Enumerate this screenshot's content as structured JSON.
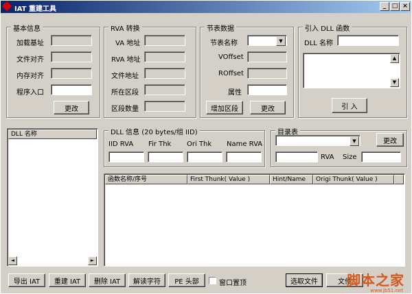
{
  "window": {
    "title": "IAT 重建工具"
  },
  "titlebar_buttons": {
    "minimize": "_",
    "maximize": "□",
    "close": "×"
  },
  "basic_info": {
    "title": "基本信息",
    "load_base": "加载基址",
    "file_align": "文件对齐",
    "mem_align": "内存对齐",
    "entry_point": "程序入口",
    "change_button": "更改"
  },
  "rva_convert": {
    "title": "RVA 转换",
    "va_addr": "VA 地址",
    "rva_addr": "RVA 地址",
    "file_addr": "文件地址",
    "section": "所在区段",
    "section_count": "区段数量"
  },
  "section_table": {
    "title": "节表数据",
    "section_name": "节表名称",
    "voffset": "VOffset",
    "roffset": "ROffset",
    "attribute": "属性",
    "add_section_button": "增加区段",
    "change_button": "更改"
  },
  "import_dll": {
    "title": "引入 DLL 函数",
    "dll_name_label": "DLL 名称",
    "import_button": "引 入"
  },
  "dll_list": {
    "header": "DLL 名称"
  },
  "dll_info": {
    "title": "DLL 信息 (20 bytes/组 IID)",
    "iid_rva": "IID RVA",
    "fir_thk": "Fir Thk",
    "ori_thk": "Ori Thk",
    "name_rva": "Name RVA"
  },
  "directory": {
    "title": "目录表",
    "change_button": "更改",
    "rva_label": "RVA",
    "size_label": "Size"
  },
  "func_table": {
    "columns": [
      "函数名称/序号",
      "First Thunk( Value )",
      "Hint/Name",
      "Origi Thunk( Value )"
    ]
  },
  "bottom_bar": {
    "export_iat": "导出 IAT",
    "rebuild_iat": "重建 IAT",
    "delete_iat": "删除 IAT",
    "decode_string": "解读字符",
    "pe_header": "PE 头部",
    "topmost_label": "窗口置顶",
    "select_file": "选取文件",
    "file_button": "文件"
  },
  "scroll": {
    "up": "▲",
    "down": "▼",
    "left": "◄",
    "right": "►"
  },
  "watermark": {
    "text": "脚本之家",
    "url": "www.jb51.net"
  }
}
